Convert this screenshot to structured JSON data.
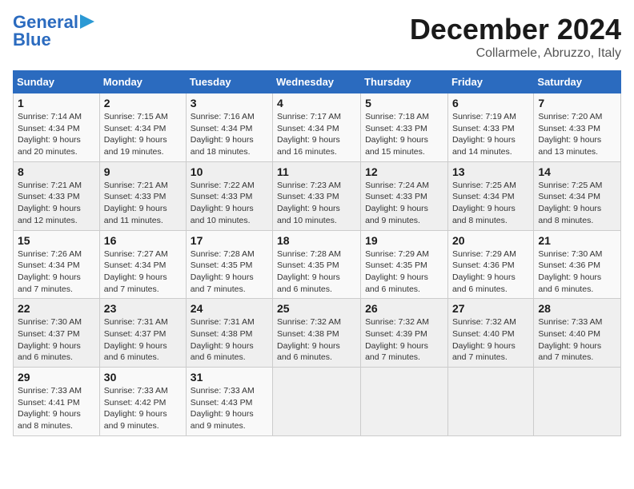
{
  "header": {
    "logo_line1": "General",
    "logo_line2": "Blue",
    "month": "December 2024",
    "location": "Collarmele, Abruzzo, Italy"
  },
  "days_of_week": [
    "Sunday",
    "Monday",
    "Tuesday",
    "Wednesday",
    "Thursday",
    "Friday",
    "Saturday"
  ],
  "weeks": [
    [
      {
        "day": "1",
        "sunrise": "7:14 AM",
        "sunset": "4:34 PM",
        "daylight": "9 hours and 20 minutes."
      },
      {
        "day": "2",
        "sunrise": "7:15 AM",
        "sunset": "4:34 PM",
        "daylight": "9 hours and 19 minutes."
      },
      {
        "day": "3",
        "sunrise": "7:16 AM",
        "sunset": "4:34 PM",
        "daylight": "9 hours and 18 minutes."
      },
      {
        "day": "4",
        "sunrise": "7:17 AM",
        "sunset": "4:34 PM",
        "daylight": "9 hours and 16 minutes."
      },
      {
        "day": "5",
        "sunrise": "7:18 AM",
        "sunset": "4:33 PM",
        "daylight": "9 hours and 15 minutes."
      },
      {
        "day": "6",
        "sunrise": "7:19 AM",
        "sunset": "4:33 PM",
        "daylight": "9 hours and 14 minutes."
      },
      {
        "day": "7",
        "sunrise": "7:20 AM",
        "sunset": "4:33 PM",
        "daylight": "9 hours and 13 minutes."
      }
    ],
    [
      {
        "day": "8",
        "sunrise": "7:21 AM",
        "sunset": "4:33 PM",
        "daylight": "9 hours and 12 minutes."
      },
      {
        "day": "9",
        "sunrise": "7:21 AM",
        "sunset": "4:33 PM",
        "daylight": "9 hours and 11 minutes."
      },
      {
        "day": "10",
        "sunrise": "7:22 AM",
        "sunset": "4:33 PM",
        "daylight": "9 hours and 10 minutes."
      },
      {
        "day": "11",
        "sunrise": "7:23 AM",
        "sunset": "4:33 PM",
        "daylight": "9 hours and 10 minutes."
      },
      {
        "day": "12",
        "sunrise": "7:24 AM",
        "sunset": "4:33 PM",
        "daylight": "9 hours and 9 minutes."
      },
      {
        "day": "13",
        "sunrise": "7:25 AM",
        "sunset": "4:34 PM",
        "daylight": "9 hours and 8 minutes."
      },
      {
        "day": "14",
        "sunrise": "7:25 AM",
        "sunset": "4:34 PM",
        "daylight": "9 hours and 8 minutes."
      }
    ],
    [
      {
        "day": "15",
        "sunrise": "7:26 AM",
        "sunset": "4:34 PM",
        "daylight": "9 hours and 7 minutes."
      },
      {
        "day": "16",
        "sunrise": "7:27 AM",
        "sunset": "4:34 PM",
        "daylight": "9 hours and 7 minutes."
      },
      {
        "day": "17",
        "sunrise": "7:28 AM",
        "sunset": "4:35 PM",
        "daylight": "9 hours and 7 minutes."
      },
      {
        "day": "18",
        "sunrise": "7:28 AM",
        "sunset": "4:35 PM",
        "daylight": "9 hours and 6 minutes."
      },
      {
        "day": "19",
        "sunrise": "7:29 AM",
        "sunset": "4:35 PM",
        "daylight": "9 hours and 6 minutes."
      },
      {
        "day": "20",
        "sunrise": "7:29 AM",
        "sunset": "4:36 PM",
        "daylight": "9 hours and 6 minutes."
      },
      {
        "day": "21",
        "sunrise": "7:30 AM",
        "sunset": "4:36 PM",
        "daylight": "9 hours and 6 minutes."
      }
    ],
    [
      {
        "day": "22",
        "sunrise": "7:30 AM",
        "sunset": "4:37 PM",
        "daylight": "9 hours and 6 minutes."
      },
      {
        "day": "23",
        "sunrise": "7:31 AM",
        "sunset": "4:37 PM",
        "daylight": "9 hours and 6 minutes."
      },
      {
        "day": "24",
        "sunrise": "7:31 AM",
        "sunset": "4:38 PM",
        "daylight": "9 hours and 6 minutes."
      },
      {
        "day": "25",
        "sunrise": "7:32 AM",
        "sunset": "4:38 PM",
        "daylight": "9 hours and 6 minutes."
      },
      {
        "day": "26",
        "sunrise": "7:32 AM",
        "sunset": "4:39 PM",
        "daylight": "9 hours and 7 minutes."
      },
      {
        "day": "27",
        "sunrise": "7:32 AM",
        "sunset": "4:40 PM",
        "daylight": "9 hours and 7 minutes."
      },
      {
        "day": "28",
        "sunrise": "7:33 AM",
        "sunset": "4:40 PM",
        "daylight": "9 hours and 7 minutes."
      }
    ],
    [
      {
        "day": "29",
        "sunrise": "7:33 AM",
        "sunset": "4:41 PM",
        "daylight": "9 hours and 8 minutes."
      },
      {
        "day": "30",
        "sunrise": "7:33 AM",
        "sunset": "4:42 PM",
        "daylight": "9 hours and 9 minutes."
      },
      {
        "day": "31",
        "sunrise": "7:33 AM",
        "sunset": "4:43 PM",
        "daylight": "9 hours and 9 minutes."
      },
      null,
      null,
      null,
      null
    ]
  ]
}
